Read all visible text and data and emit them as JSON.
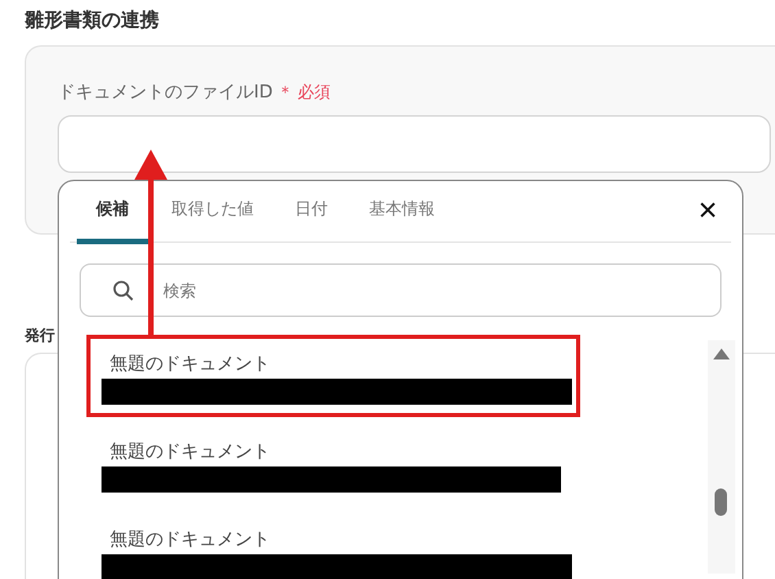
{
  "section_title": "雛形書類の連携",
  "field": {
    "label": "ドキュメントのファイルID",
    "required_mark": "＊",
    "required_text": "必須"
  },
  "second_section_title": "発行",
  "popup": {
    "tabs": [
      {
        "label": "候補",
        "selected": true
      },
      {
        "label": "取得した値",
        "selected": false
      },
      {
        "label": "日付",
        "selected": false
      },
      {
        "label": "基本情報",
        "selected": false
      }
    ],
    "close": "×",
    "search": {
      "placeholder": "検索"
    },
    "items": [
      {
        "title": "無題のドキュメント",
        "redacted": true,
        "highlighted": true
      },
      {
        "title": "無題のドキュメント",
        "redacted": true,
        "highlighted": false
      },
      {
        "title": "無題のドキュメント",
        "redacted": true,
        "highlighted": false
      }
    ]
  }
}
